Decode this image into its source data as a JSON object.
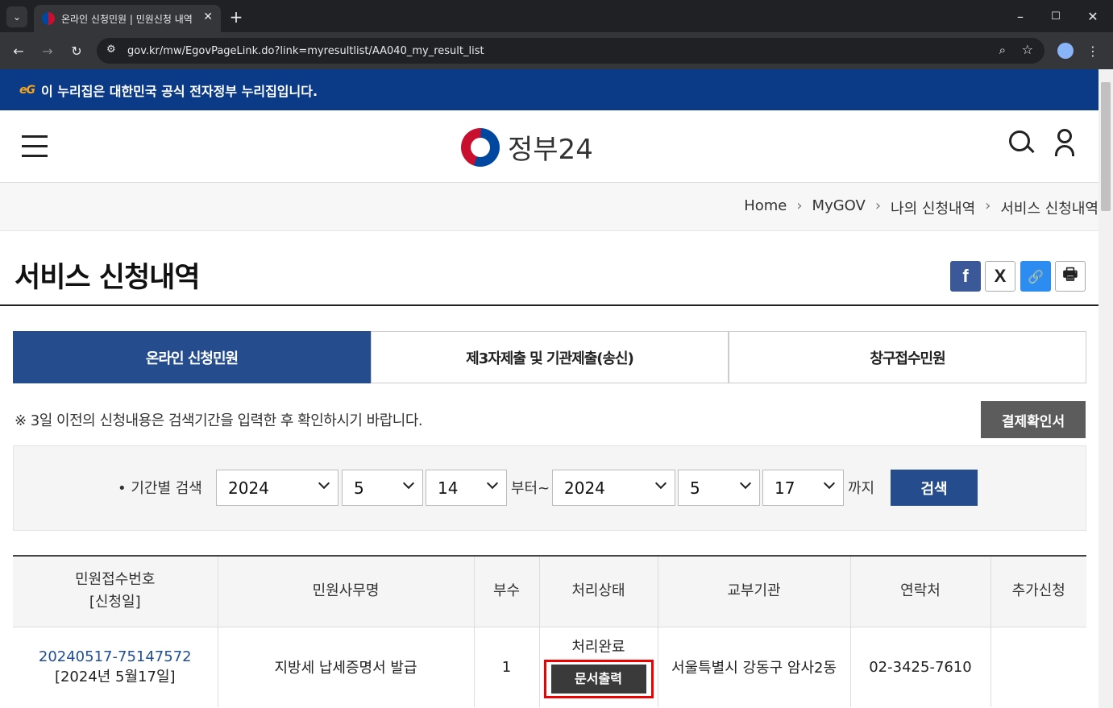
{
  "browser": {
    "tab_title": "온라인 신청민원 | 민원신청 내역",
    "url": "gov.kr/mw/EgovPageLink.do?link=myresultlist/AA040_my_result_list"
  },
  "banner": {
    "eg": "eG",
    "text": "이 누리집은 대한민국 공식 전자정부 누리집입니다."
  },
  "header": {
    "logo_text": "정부24"
  },
  "breadcrumb": [
    "Home",
    "MyGOV",
    "나의 신청내역",
    "서비스 신청내역"
  ],
  "page": {
    "title": "서비스 신청내역"
  },
  "share": {
    "facebook": "f",
    "x": "X",
    "link": "🔗",
    "print": "🖶"
  },
  "tabs": [
    "온라인 신청민원",
    "제3자제출 및 기관제출(송신)",
    "창구접수민원"
  ],
  "notice": "※ 3일 이전의 신청내용은 검색기간을 입력한 후 확인하시기 바랍니다.",
  "receipt_button": "결제확인서",
  "search": {
    "label": "• 기간별 검색",
    "from": {
      "year": "2024",
      "month": "5",
      "day": "14"
    },
    "from_suffix": "부터~",
    "to": {
      "year": "2024",
      "month": "5",
      "day": "17"
    },
    "to_suffix": "까지",
    "button": "검색"
  },
  "table": {
    "headers": [
      "민원접수번호",
      "[신청일]",
      "민원사무명",
      "부수",
      "처리상태",
      "교부기관",
      "연락처",
      "추가신청"
    ],
    "rows": [
      {
        "receipt_no": "20240517-75147572",
        "date": "[2024년 5월17일]",
        "service": "지방세 납세증명서 발급",
        "copies": "1",
        "status": "처리완료",
        "action": "문서출력",
        "agency": "서울특별시 강동구 암사2동",
        "phone": "02-3425-7610",
        "extra": ""
      }
    ]
  }
}
